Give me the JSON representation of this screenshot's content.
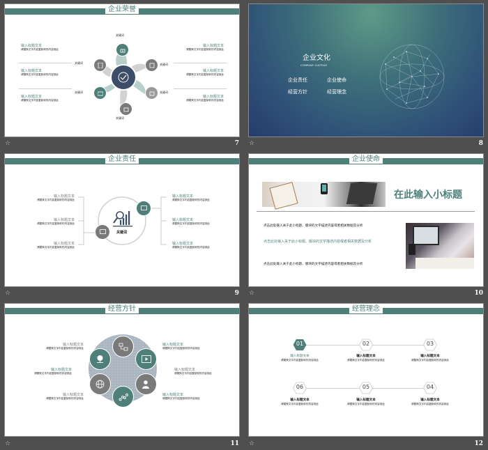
{
  "slides": [
    {
      "number": "7",
      "title": "企业荣誉",
      "left_items": [
        {
          "title": "输入标题文本",
          "desc": "请替换文字内容复制你的内容到此"
        },
        {
          "title": "输入标题文本",
          "desc": "请替换文字内容复制你的内容到此"
        },
        {
          "title": "输入标题文本",
          "desc": "请替换文字内容复制你的内容到此"
        }
      ],
      "right_items": [
        {
          "title": "输入标题文本",
          "desc": "请替换文字内容复制你的内容到此"
        },
        {
          "title": "输入标题文本",
          "desc": "请替换文字内容复制你的内容到此"
        },
        {
          "title": "输入标题文本",
          "desc": "请替换文字内容复制你的内容到此"
        }
      ],
      "keywords": [
        "关键词",
        "关键词",
        "关键词",
        "关键词",
        "关键词",
        "关键词"
      ],
      "center_icon": "check-icon"
    },
    {
      "number": "8",
      "title": "企业文化",
      "subtitle": "COMPANY  CULTRUE",
      "items": [
        "企业责任",
        "企业使命",
        "经营方针",
        "经营理念"
      ]
    },
    {
      "number": "9",
      "title": "企业责任",
      "center_label": "关键词",
      "left_items": [
        {
          "title": "输入标题文本",
          "desc": "请替换文字内容复制你的内容到此"
        },
        {
          "title": "输入标题文本",
          "desc": "请替换文字内容复制你的内容到此"
        },
        {
          "title": "输入标题文本",
          "desc": "请替换文字内容复制你的内容到此"
        }
      ],
      "right_items": [
        {
          "title": "输入标题文本",
          "desc": "请替换文字内容复制你的内容到此"
        },
        {
          "title": "输入标题文本",
          "desc": "请替换文字内容复制你的内容到此"
        },
        {
          "title": "输入标题文本",
          "desc": "请替换文字内容复制你的内容到此"
        }
      ]
    },
    {
      "number": "10",
      "title": "企业使命",
      "heading": "在此输入小标题",
      "paragraphs": [
        "点击此处输入关于此小标题、版块的文字描述内容或者相关数据及分析",
        "点击此处输入关于此小标题、版块的文字描述内容或者相关数据及分析",
        "点击此处输入关于此小标题、版块的文字描述内容或者相关数据及分析"
      ]
    },
    {
      "number": "11",
      "title": "经营方针",
      "left_items": [
        {
          "title": "输入标题文本",
          "desc": "请替换文字内容复制你的内容到此"
        },
        {
          "title": "输入标题文本",
          "desc": "请替换文字内容复制你的内容到此"
        },
        {
          "title": "输入标题文本",
          "desc": "请替换文字内容复制你的内容到此"
        }
      ],
      "right_items": [
        {
          "title": "输入标题文本",
          "desc": "请替换文字内容复制你的内容到此"
        },
        {
          "title": "输入标题文本",
          "desc": "请替换文字内容复制你的内容到此"
        },
        {
          "title": "输入标题文本",
          "desc": "请替换文字内容复制你的内容到此"
        }
      ]
    },
    {
      "number": "12",
      "title": "经营理念",
      "steps": [
        {
          "num": "01",
          "title": "输入标题文本",
          "desc": "请替换文字内容复制你的内容到此"
        },
        {
          "num": "02",
          "title": "输入标题文本",
          "desc": "请替换文字内容复制你的内容到此"
        },
        {
          "num": "03",
          "title": "输入标题文本",
          "desc": "请替换文字内容复制你的内容到此"
        },
        {
          "num": "04",
          "title": "输入标题文本",
          "desc": "请替换文字内容复制你的内容到此"
        },
        {
          "num": "05",
          "title": "输入标题文本",
          "desc": "请替换文字内容复制你的内容到此"
        },
        {
          "num": "06",
          "title": "输入标题文本",
          "desc": "请替换文字内容复制你的内容到此"
        }
      ]
    }
  ],
  "footer_icon": "star-icon",
  "footer_star": "☆",
  "colors": {
    "accent": "#4e7f79",
    "gray": "#7a7a7a",
    "navy": "#3d4c67",
    "background": "#4f4f4f"
  }
}
